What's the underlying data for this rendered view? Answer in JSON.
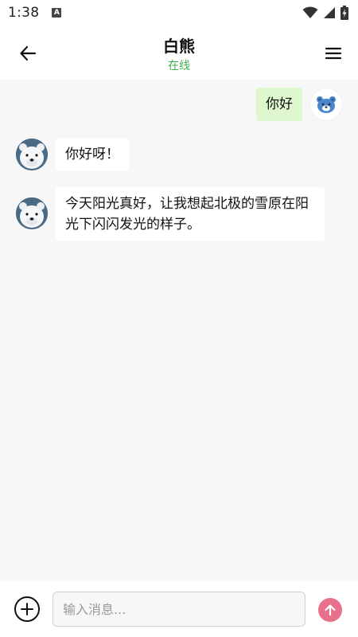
{
  "status_bar": {
    "time": "1:38",
    "indicator": "A",
    "icons": [
      "wifi-icon",
      "signal-icon",
      "battery-charging-icon"
    ]
  },
  "header": {
    "back_icon": "arrow-left-icon",
    "title": "白熊",
    "status": "在线",
    "menu_icon": "menu-icon"
  },
  "messages": [
    {
      "sender": "me",
      "text": "你好"
    },
    {
      "sender": "bear",
      "text": "你好呀！"
    },
    {
      "sender": "bear",
      "text": "今天阳光真好，让我想起北极的雪原在阳光下闪闪发光的样子。"
    }
  ],
  "input": {
    "placeholder": "输入消息...",
    "value": "",
    "add_icon": "plus-circle-icon",
    "send_icon": "arrow-up-icon"
  },
  "colors": {
    "online": "#3fae4f",
    "outgoing_bubble": "#dff7cf",
    "incoming_bubble": "#ffffff",
    "send_button": "#e8708c",
    "background": "#f7f7f7"
  }
}
